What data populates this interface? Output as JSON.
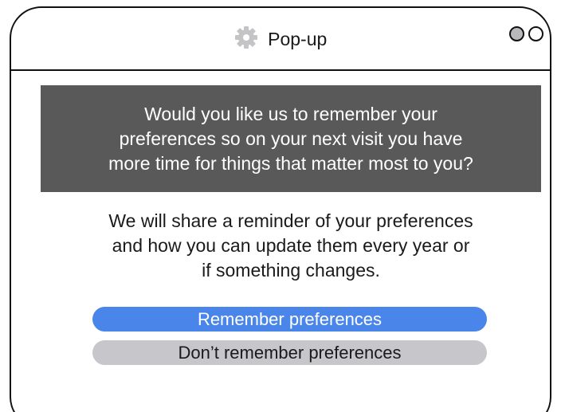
{
  "window": {
    "title": "Pop-up",
    "title_icon": "gear-icon",
    "controls": [
      "circle-filled",
      "circle-empty"
    ]
  },
  "banner": {
    "lines": [
      "Would you like us to remember your",
      "preferences so on your next visit you have",
      "more time for things that matter most to you?"
    ]
  },
  "body": {
    "lines": [
      "We will share a reminder of your preferences",
      "and how you can update them every year or",
      "if something changes."
    ]
  },
  "buttons": {
    "remember_label": "Remember preferences",
    "dont_remember_label": "Don’t remember preferences"
  },
  "colors": {
    "banner_bg": "#595959",
    "primary_button": "#4a86ea",
    "secondary_button": "#c7c7cb",
    "window_control_fill": "#b9b9bc"
  }
}
